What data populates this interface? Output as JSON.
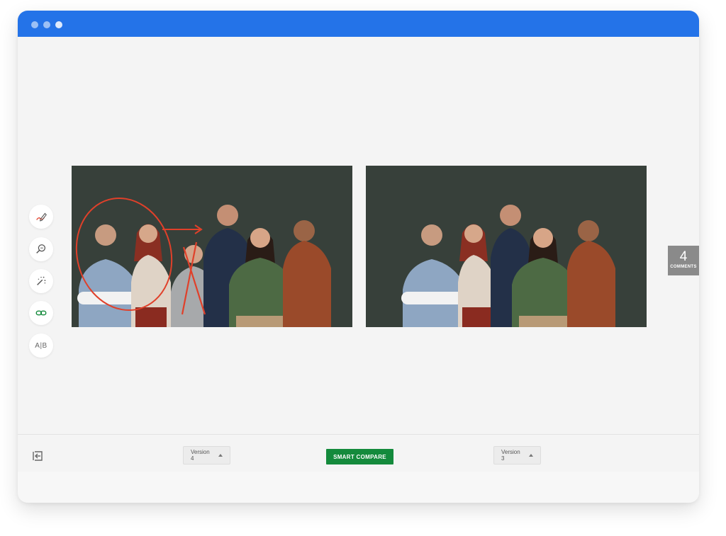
{
  "toolbar": {
    "tools": [
      {
        "name": "annotate",
        "icon": "pen-icon"
      },
      {
        "name": "zoom",
        "icon": "magnify-icon"
      },
      {
        "name": "magic",
        "icon": "magic-wand-icon"
      },
      {
        "name": "link",
        "icon": "link-icon"
      },
      {
        "name": "ab-compare",
        "icon": "ab-icon",
        "label": "A|B"
      }
    ]
  },
  "comments": {
    "count": "4",
    "label": "COMMENTS"
  },
  "footer": {
    "left_version": "Version 4",
    "right_version": "Version 3",
    "smart_compare_label": "SMART COMPARE"
  },
  "colors": {
    "titlebar": "#2473e8",
    "accent_green": "#148a3c",
    "annotation_red": "#e0402a",
    "photo_background": "#37403a"
  }
}
